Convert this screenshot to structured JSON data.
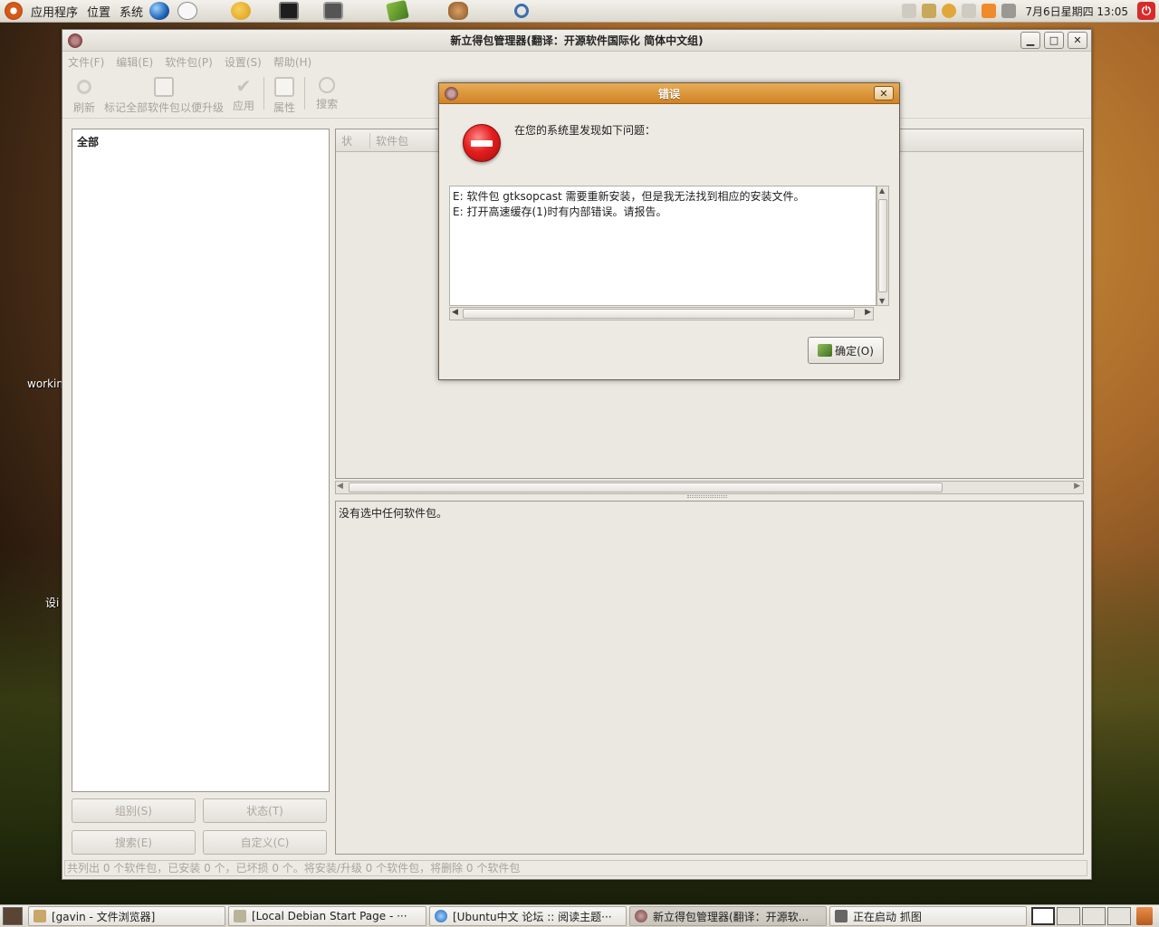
{
  "top_panel": {
    "menus": [
      "应用程序",
      "位置",
      "系统"
    ],
    "clock": "7月6日星期四 13:05"
  },
  "desktop": {
    "labels": [
      "workin",
      "设i"
    ]
  },
  "main_window": {
    "title": "新立得包管理器(翻译：开源软件国际化 简体中文组)",
    "menu": [
      "文件(F)",
      "编辑(E)",
      "软件包(P)",
      "设置(S)",
      "帮助(H)"
    ],
    "toolbar": {
      "refresh": "刷新",
      "mark_all_upgrades": "标记全部软件包以便升级",
      "apply": "应用",
      "properties": "属性",
      "search": "搜索"
    },
    "filter_all": "全部",
    "left_buttons": {
      "sections": "组别(S)",
      "status": "状态(T)",
      "search": "搜索(E)",
      "custom": "自定义(C)"
    },
    "columns": {
      "status": "状",
      "package": "软件包"
    },
    "details_text": "没有选中任何软件包。",
    "status_bar": "共列出 0 个软件包，已安装 0 个，已坏损 0 个。将安装/升级 0 个软件包，将删除 0 个软件包"
  },
  "dialog": {
    "title": "错误",
    "message": "在您的系统里发现如下问题：",
    "errors": [
      "E: 软件包 gtksopcast 需要重新安装，但是我无法找到相应的安装文件。",
      "E: 打开高速缓存(1)时有内部错误。请报告。"
    ],
    "ok_label": "确定(O)"
  },
  "taskbar": {
    "tasks": [
      "[gavin - 文件浏览器]",
      "[Local Debian Start Page - ···",
      "[Ubuntu中文 论坛 :: 阅读主题···",
      "新立得包管理器(翻译：开源软...",
      "正在启动 抓图"
    ]
  }
}
